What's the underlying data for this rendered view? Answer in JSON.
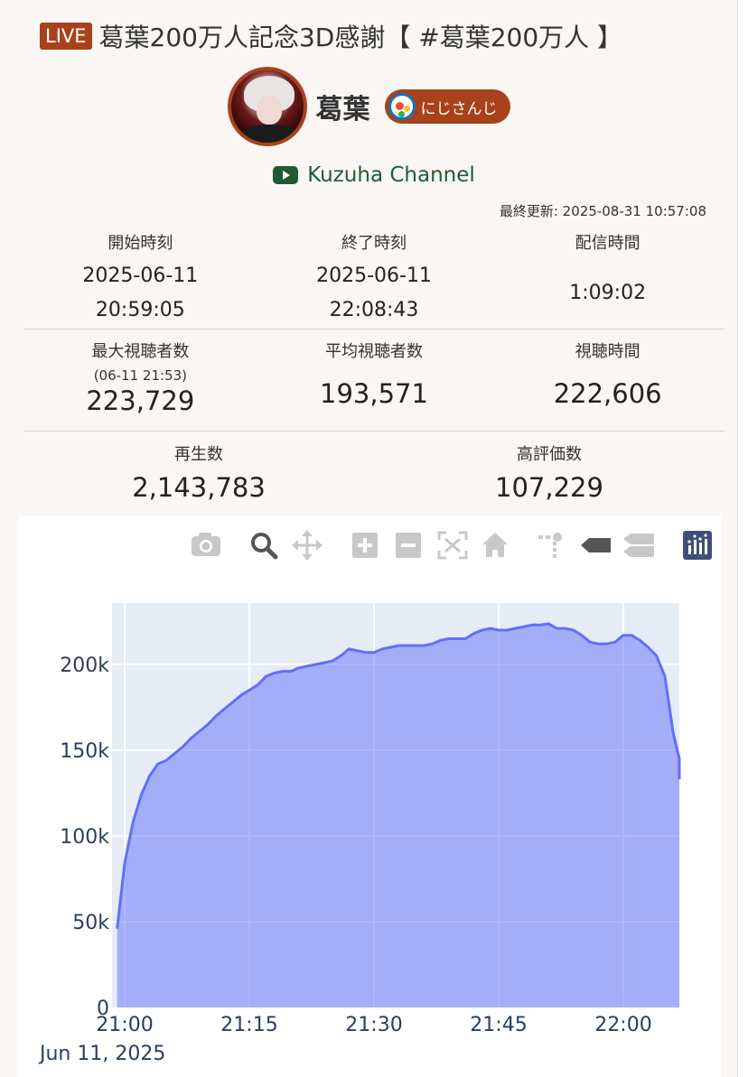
{
  "header": {
    "live_badge": "LIVE",
    "title": "葛葉200万人記念3D感謝【 #葛葉200万人 】"
  },
  "channel": {
    "name": "葛葉",
    "org": "にじさんじ",
    "youtube_label": "Kuzuha Channel"
  },
  "last_updated": "最終更新: 2025-08-31 10:57:08",
  "stats": {
    "start_label": "開始時刻",
    "start_date": "2025-06-11",
    "start_time": "20:59:05",
    "end_label": "終了時刻",
    "end_date": "2025-06-11",
    "end_time": "22:08:43",
    "duration_label": "配信時間",
    "duration": "1:09:02",
    "max_viewers_label": "最大視聴者数",
    "max_viewers_at": "(06-11 21:53)",
    "max_viewers": "223,729",
    "avg_viewers_label": "平均視聴者数",
    "avg_viewers": "193,571",
    "watch_time_label": "視聴時間",
    "watch_time": "222,606",
    "views_label": "再生数",
    "views": "2,143,783",
    "likes_label": "高評価数",
    "likes": "107,229"
  },
  "modebar": [
    "camera-icon",
    "zoom-icon",
    "pan-icon",
    "zoom-in-icon",
    "zoom-out-icon",
    "autoscale-icon",
    "reset-axes-icon",
    "spike-lines-icon",
    "hover-closest-icon",
    "hover-compare-icon",
    "plotly-logo-icon"
  ],
  "colors": {
    "accent": "#a8421b",
    "channel_green": "#1f5b35",
    "line": "#636efa",
    "plot_bg": "#e5ecf6"
  },
  "chart_data": {
    "type": "area",
    "x_ticks": [
      "21:00",
      "21:15",
      "21:30",
      "21:45",
      "22:00"
    ],
    "x_date_label": "Jun 11, 2025",
    "y_ticks": [
      "0",
      "50k",
      "100k",
      "150k",
      "200k"
    ],
    "ylim": [
      0,
      235000
    ],
    "x_unit": "minutes",
    "xlim": [
      -0.9,
      67.8
    ],
    "grid": true,
    "series": [
      {
        "x": [
          -0.9,
          0,
          1,
          2,
          3,
          4,
          5,
          6,
          7,
          8,
          9,
          10,
          11,
          12,
          13,
          14,
          15,
          16,
          17,
          18,
          19,
          20,
          21,
          22,
          23,
          24,
          25,
          26,
          27,
          28,
          29,
          30,
          31,
          32,
          33,
          34,
          35,
          36,
          37,
          38,
          39,
          40,
          41,
          42,
          43,
          44,
          45,
          46,
          47,
          48,
          49,
          50,
          51,
          52,
          53,
          54,
          55,
          56,
          57,
          58,
          59,
          60,
          61,
          62,
          63,
          64,
          65,
          66,
          67,
          67.8
        ],
        "values": [
          46000,
          84000,
          108000,
          124000,
          135000,
          142000,
          144000,
          148000,
          152000,
          157000,
          161000,
          165000,
          170000,
          174000,
          178000,
          182000,
          185000,
          188000,
          193000,
          195000,
          196000,
          196000,
          198000,
          199000,
          200000,
          201000,
          202000,
          205000,
          209000,
          208000,
          207000,
          207000,
          209000,
          210000,
          211000,
          211000,
          211000,
          211000,
          212000,
          214000,
          215000,
          215000,
          215000,
          218000,
          220000,
          221000,
          220000,
          220000,
          221000,
          222000,
          223000,
          223000,
          223729,
          221000,
          221000,
          220000,
          217000,
          213000,
          212000,
          212000,
          213000,
          217000,
          217000,
          214000,
          210000,
          205000,
          193000,
          160000,
          145000,
          133000
        ]
      }
    ]
  }
}
